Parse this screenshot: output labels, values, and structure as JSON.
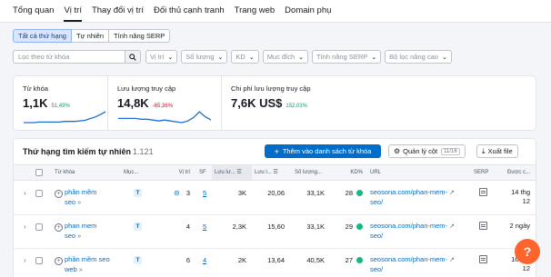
{
  "tabs": [
    "Tổng quan",
    "Vị trí",
    "Thay đổi vị trí",
    "Đối thủ cạnh tranh",
    "Trang web",
    "Domain phụ"
  ],
  "subtabs": [
    "Tất cả thứ hạng",
    "Tự nhiên",
    "Tính năng SERP"
  ],
  "filters": {
    "search_placeholder": "Lọc theo từ khóa",
    "dropdowns": [
      "Vị trí",
      "Số lượng",
      "KD",
      "Mục đích",
      "Tính năng SERP",
      "Bộ lọc nâng cao"
    ]
  },
  "stats": [
    {
      "label": "Từ khóa",
      "value": "1,1K",
      "change": "51,49%",
      "trend": [
        3,
        3,
        3,
        4,
        4,
        4,
        4,
        4,
        5,
        5,
        5,
        6,
        7,
        10,
        13,
        17,
        22
      ]
    },
    {
      "label": "Lưu lượng truy cập",
      "value": "14,8K",
      "change": "-65,36%",
      "trend": [
        14,
        14,
        14,
        14,
        13,
        13,
        12,
        11,
        12,
        11,
        10,
        9,
        11,
        15,
        22,
        16,
        12
      ]
    },
    {
      "label": "Chi phí lưu lượng truy cập",
      "value": "7,6K US$",
      "change": "152,03%"
    }
  ],
  "table": {
    "title": "Thứ hạng tìm kiếm tự nhiên",
    "count": "1.121",
    "add_button": "Thêm vào danh sách từ khóa",
    "manage_columns": "Quản lý cột",
    "columns_count": "11/16",
    "export": "Xuất file",
    "headers": {
      "keyword": "Từ khóa",
      "intent": "Mục...",
      "position": "Vị trí",
      "sf": "SF",
      "traffic": "Lưu lư...",
      "traffic_pct": "Lưu l...",
      "volume": "Số lượng...",
      "kd": "KD%",
      "url": "URL",
      "serp": "SERP",
      "updated": "Được c..."
    },
    "rows": [
      {
        "kw1": "phần mềm",
        "kw2": "seo",
        "intent": "T",
        "position": "3",
        "sf": "5",
        "traffic": "3K",
        "traffic_pct": "20,06",
        "volume": "33,1K",
        "kd": "28",
        "url1": "seosona.com/phan-mem-",
        "url2": "seo/",
        "updated1": "14 thg",
        "updated2": "12"
      },
      {
        "kw1": "phan mem",
        "kw2": "seo",
        "intent": "T",
        "position": "4",
        "sf": "5",
        "traffic": "2,3K",
        "traffic_pct": "15,60",
        "volume": "33,1K",
        "kd": "29",
        "url1": "seosona.com/phan-mem-",
        "url2": "seo/",
        "updated1": "2 ngày",
        "updated2": ""
      },
      {
        "kw1": "phần mềm seo",
        "kw2": "web",
        "intent": "T",
        "position": "6",
        "sf": "4",
        "traffic": "2K",
        "traffic_pct": "13,64",
        "volume": "40,5K",
        "kd": "27",
        "url1": "seosona.com/phan-mem-",
        "url2": "seo/",
        "updated1": "16 thg",
        "updated2": "12"
      }
    ]
  },
  "help_label": "?",
  "colors": {
    "accent": "#006dca",
    "kd_dot": "#12b886",
    "help": "#ff642d",
    "spark": "#1b6fd6"
  }
}
